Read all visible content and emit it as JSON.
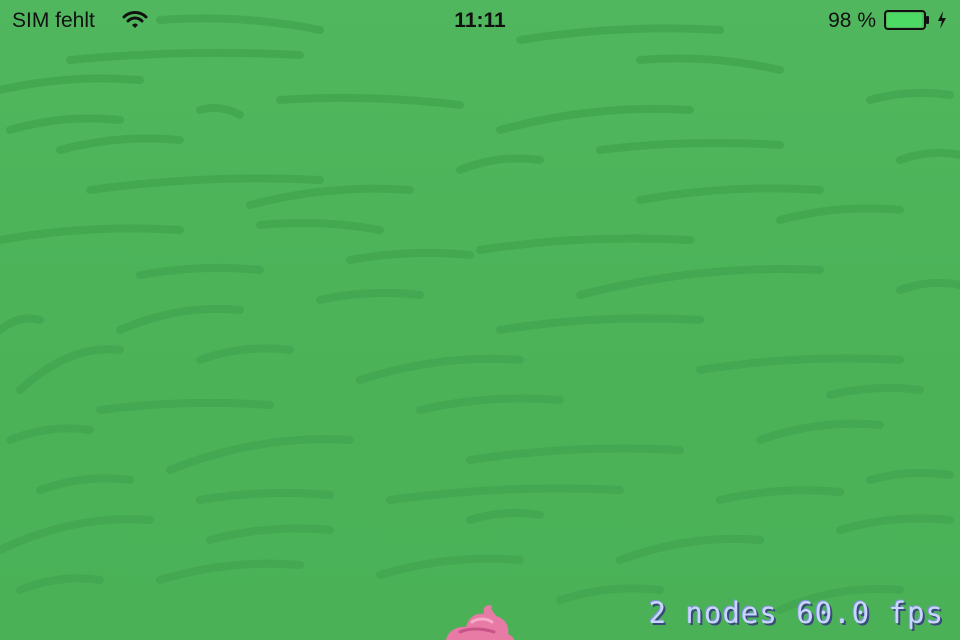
{
  "status_bar": {
    "carrier": "SIM fehlt",
    "time": "11:11",
    "battery_percent": "98 %",
    "battery_level": 0.98,
    "wifi_icon": "wifi-icon",
    "battery_icon": "battery-icon",
    "charging_icon": "lightning-bolt-icon"
  },
  "game": {
    "background": "grass",
    "colors": {
      "grass": "#4cb359",
      "grass_stroke": "#43a650",
      "sprite": "#e87aa6",
      "stats_text": "#c9d6ff"
    },
    "debug_stats": {
      "nodes": "2 nodes",
      "fps": "60.0 fps"
    },
    "sprite": "pink-cupcake-sprite"
  }
}
